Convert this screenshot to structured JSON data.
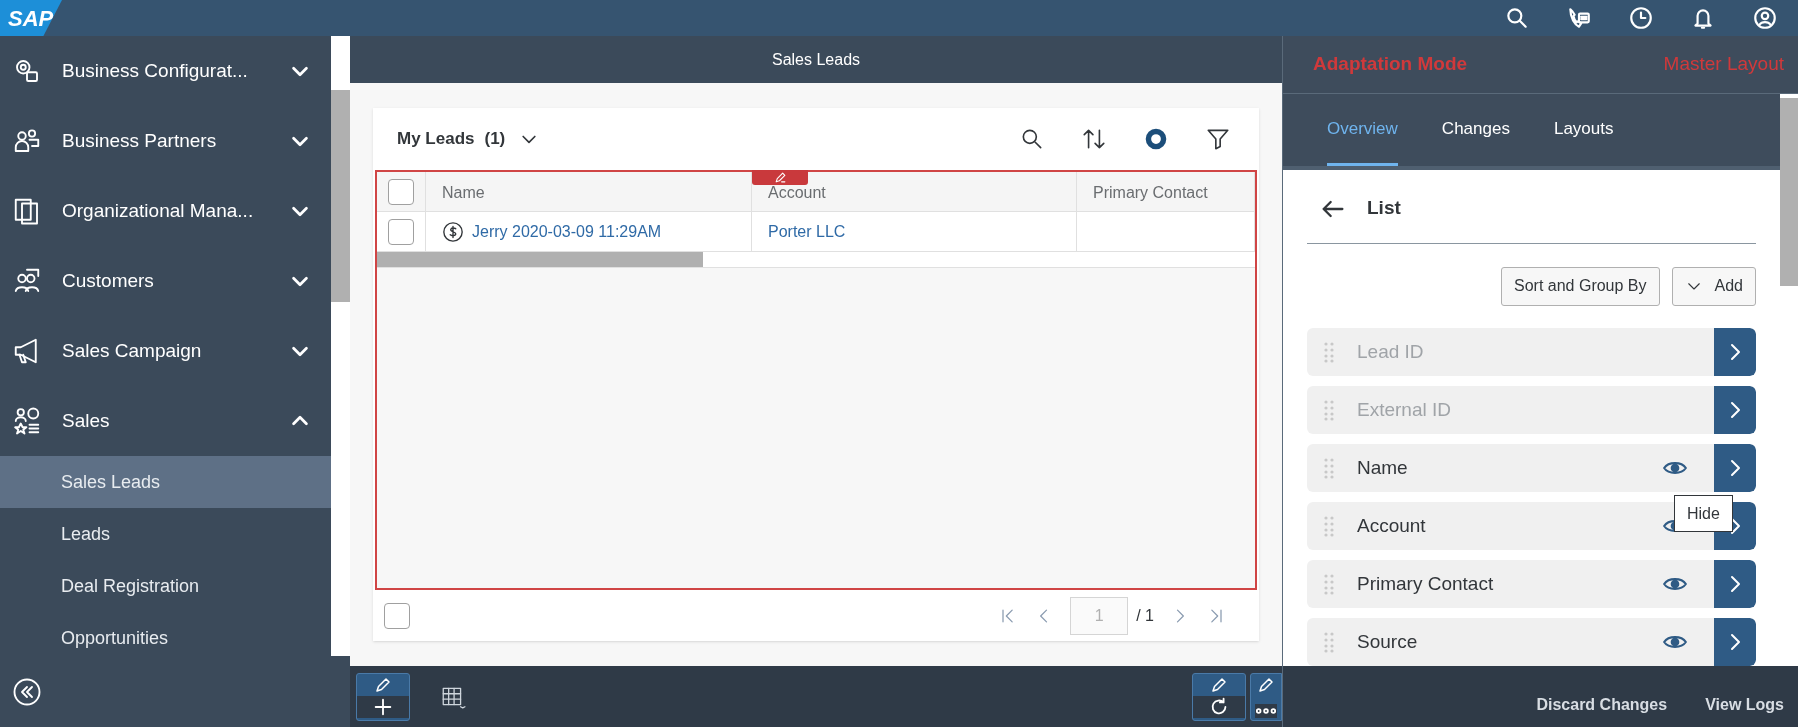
{
  "logo": "SAP",
  "sidebar": {
    "items": [
      {
        "label": "Business Configurat...",
        "expanded": false
      },
      {
        "label": "Business Partners",
        "expanded": false
      },
      {
        "label": "Organizational Mana...",
        "expanded": false
      },
      {
        "label": "Customers",
        "expanded": false
      },
      {
        "label": "Sales Campaign",
        "expanded": false
      },
      {
        "label": "Sales",
        "expanded": true,
        "children": [
          {
            "label": "Sales Leads",
            "selected": true
          },
          {
            "label": "Leads",
            "selected": false
          },
          {
            "label": "Deal Registration",
            "selected": false
          },
          {
            "label": "Opportunities",
            "selected": false
          }
        ]
      }
    ]
  },
  "main": {
    "title": "Sales Leads",
    "list": {
      "view": "My Leads",
      "count": "(1)",
      "select_all": {
        "checked": false
      },
      "columns": [
        "Name",
        "Account",
        "Primary Contact"
      ],
      "rows": [
        {
          "checked": false,
          "cells": [
            "Jerry 2020-03-09 11:29AM",
            "Porter LLC",
            ""
          ]
        }
      ],
      "footer_checkbox": {
        "checked": false
      },
      "pagination": {
        "page": "1",
        "total": "/ 1"
      }
    }
  },
  "adaptation": {
    "title": "Adaptation Mode",
    "layout": "Master Layout",
    "tabs": [
      {
        "label": "Overview",
        "selected": true
      },
      {
        "label": "Changes",
        "selected": false
      },
      {
        "label": "Layouts",
        "selected": false
      }
    ],
    "section": "List",
    "buttons": [
      "Sort and Group By",
      "Add"
    ],
    "fields": [
      {
        "label": "Lead ID",
        "enabled": false
      },
      {
        "label": "External ID",
        "enabled": false
      },
      {
        "label": "Name",
        "enabled": true
      },
      {
        "label": "Account",
        "enabled": true
      },
      {
        "label": "Primary Contact",
        "enabled": true
      },
      {
        "label": "Source",
        "enabled": true
      }
    ],
    "tooltip": "Hide",
    "footer": [
      "Discard Changes",
      "View Logs"
    ]
  }
}
